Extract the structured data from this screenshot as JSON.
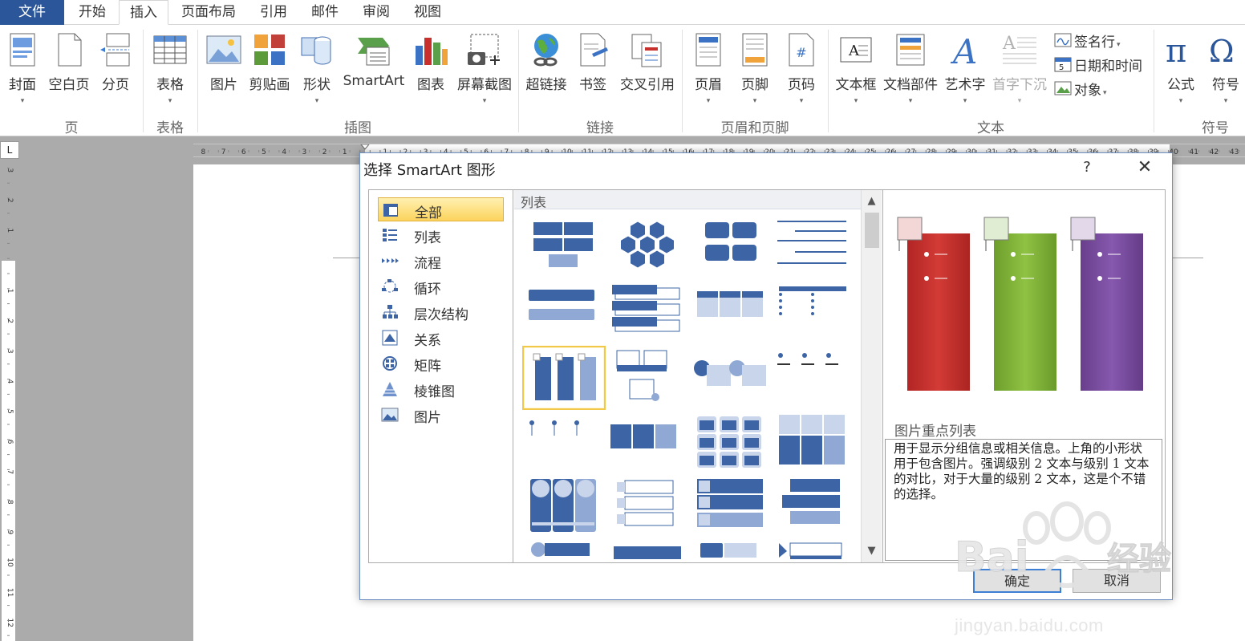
{
  "ribbon_tabs": [
    "文件",
    "开始",
    "插入",
    "页面布局",
    "引用",
    "邮件",
    "审阅",
    "视图"
  ],
  "ribbon": {
    "buttons": {
      "cover": "封面",
      "blank_page": "空白页",
      "page_break": "分页",
      "table": "表格",
      "picture": "图片",
      "clipart": "剪贴画",
      "shapes": "形状",
      "smartart": "SmartArt",
      "chart": "图表",
      "screenshot": "屏幕截图",
      "hyperlink": "超链接",
      "bookmark": "书签",
      "crossref": "交叉引用",
      "header": "页眉",
      "footer": "页脚",
      "page_number": "页码",
      "textbox": "文本框",
      "quickparts": "文档部件",
      "wordart": "艺术字",
      "dropcap": "首字下沉",
      "signature": "签名行",
      "datetime": "日期和时间",
      "object": "对象",
      "equation": "公式",
      "symbol": "符号"
    },
    "groups": {
      "pages": "页",
      "tables": "表格",
      "illustrations": "插图",
      "links": "链接",
      "header_footer": "页眉和页脚",
      "text": "文本",
      "symbols": "符号"
    }
  },
  "ruler": {
    "h_left": [
      "8",
      "7",
      "6",
      "5",
      "4",
      "3",
      "2",
      "1"
    ],
    "h_right": [
      "1",
      "2",
      "3",
      "4",
      "5",
      "6",
      "7",
      "8",
      "9",
      "10",
      "11",
      "12",
      "13",
      "14",
      "15",
      "16",
      "17",
      "18",
      "19",
      "20",
      "21",
      "22",
      "23",
      "24",
      "25",
      "26",
      "27",
      "28",
      "29",
      "30",
      "31",
      "32",
      "33",
      "34",
      "35",
      "36",
      "37",
      "38",
      "39",
      "40",
      "41",
      "42",
      "43"
    ],
    "v_top": [
      "3",
      "2",
      "1"
    ],
    "v_bottom": [
      "1",
      "2",
      "3",
      "4",
      "5",
      "6",
      "7",
      "8",
      "9",
      "10",
      "11",
      "12"
    ],
    "corner": "L"
  },
  "dialog": {
    "title": "选择 SmartArt 图形",
    "help": "?",
    "close": "✕",
    "categories": [
      "全部",
      "列表",
      "流程",
      "循环",
      "层次结构",
      "关系",
      "矩阵",
      "棱锥图",
      "图片"
    ],
    "gallery_header": "列表",
    "selected_name": "图片重点列表",
    "description": "用于显示分组信息或相关信息。上角的小形状用于包含图片。强调级别 2 文本与级别 1 文本的对比，对于大量的级别 2 文本，这是个不错的选择。",
    "ok": "确定",
    "cancel": "取消",
    "scroll_up": "▲",
    "scroll_down": "▼"
  },
  "colors": {
    "accent": "#2b579a",
    "smart_blue": "#3d64a5",
    "red": "#c8302e",
    "green": "#7fb23a",
    "purple": "#7a4e9e",
    "selected": "#fcd35c"
  },
  "watermark": {
    "brand_text": "Bai",
    "brand_cn": "经验",
    "url": "jingyan.baidu.com"
  }
}
